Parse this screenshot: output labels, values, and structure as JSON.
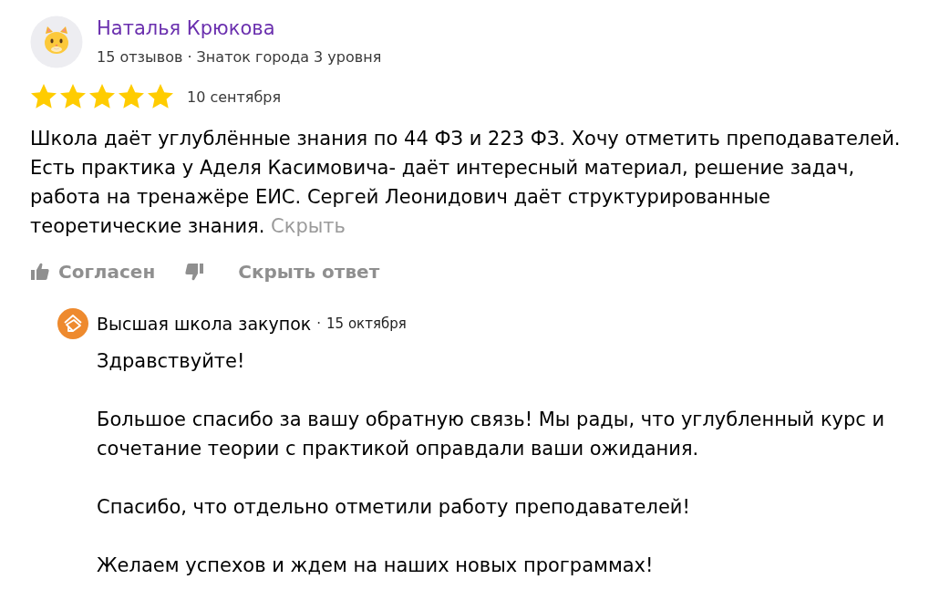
{
  "review": {
    "author": {
      "name": "Наталья Крюкова",
      "meta": "15 отзывов · Знаток города 3 уровня"
    },
    "stars": 5,
    "date": "10 сентября",
    "text": "Школа даёт углублённые знания по 44 ФЗ и 223 ФЗ. Хочу отметить преподавателей. Есть практика у Аделя Касимовича- даёт интересный материал, решение задач, работа на тренажёре ЕИС. Сергей Леонидович даёт структурированные теоретические знания.",
    "hide_link": "Скрыть",
    "actions": [
      {
        "kind": "like",
        "label": "Согласен"
      },
      {
        "kind": "dislike"
      },
      {
        "kind": "toggle",
        "label": "Скрыть ответ"
      }
    ]
  },
  "reply": {
    "author": "Высшая школа закупок",
    "separator": "·",
    "date": "15 октября",
    "paragraphs": [
      "Здравствуйте!",
      "Большое спасибо за вашу обратную связь! Мы рады, что углубленный курс и сочетание теории с практикой оправдали ваши ожидания.",
      "Спасибо, что отдельно отметили работу преподавателей!",
      "Желаем успехов и ждем на наших новых программах!"
    ]
  }
}
